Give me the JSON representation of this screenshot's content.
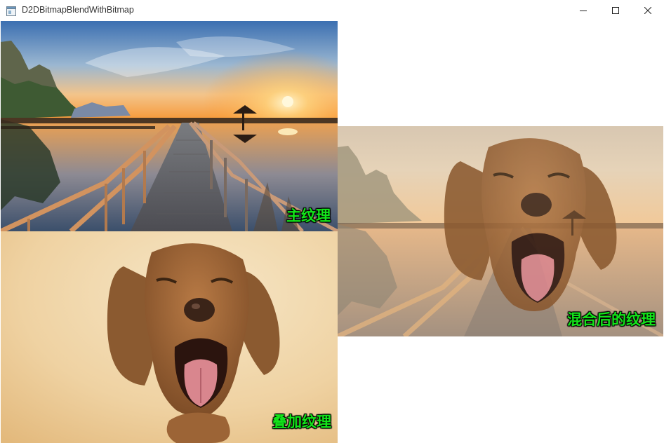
{
  "window": {
    "title": "D2DBitmapBlendWithBitmap",
    "icon": "app-window-icon",
    "controls": {
      "minimize": "minimize-icon",
      "maximize": "maximize-icon",
      "close": "close-icon"
    }
  },
  "panels": {
    "main": {
      "label": "主纹理"
    },
    "overlay": {
      "label": "叠加纹理"
    },
    "blended": {
      "label": "混合后的纹理"
    }
  },
  "colors": {
    "label_text": "#13e51a",
    "label_outline": "#000000",
    "titlebar": "#ffffff"
  }
}
